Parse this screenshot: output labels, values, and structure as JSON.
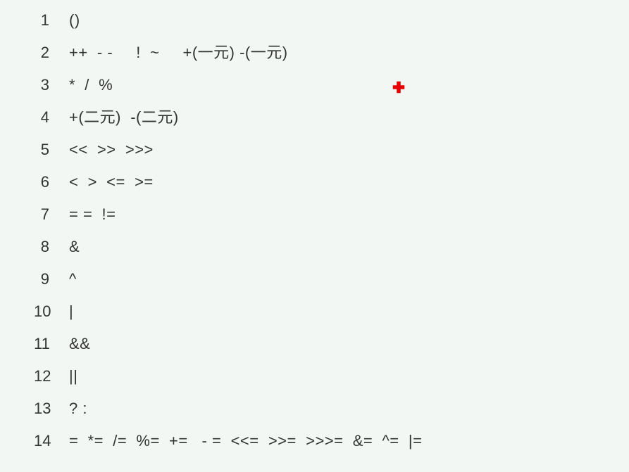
{
  "lines": [
    {
      "n": "1",
      "t": "()"
    },
    {
      "n": "2",
      "t": "++  - -     !  ~     +(一元) -(一元)"
    },
    {
      "n": "3",
      "t": "*  /  %"
    },
    {
      "n": "4",
      "t": "+(二元)  -(二元)"
    },
    {
      "n": "5",
      "t": "<<  >>  >>>"
    },
    {
      "n": "6",
      "t": "<  >  <=  >="
    },
    {
      "n": "7",
      "t": "= =  !="
    },
    {
      "n": "8",
      "t": "&"
    },
    {
      "n": "9",
      "t": "^"
    },
    {
      "n": "10",
      "t": "|"
    },
    {
      "n": "11",
      "t": "&&"
    },
    {
      "n": "12",
      "t": "||"
    },
    {
      "n": "13",
      "t": "? :"
    },
    {
      "n": "14",
      "t": "=  *=  /=  %=  +=   - =  <<=  >>=  >>>=  &=  ^=  |="
    }
  ],
  "marker": {
    "color": "#e60000"
  }
}
